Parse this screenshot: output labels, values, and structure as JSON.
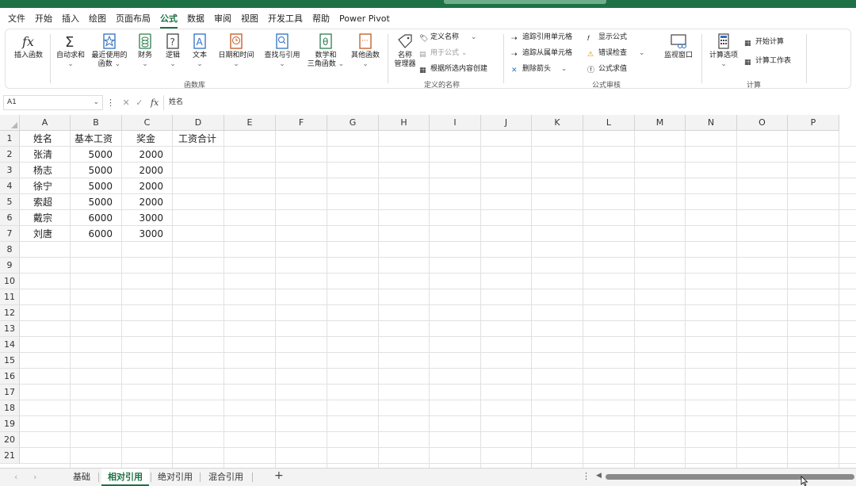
{
  "menu": [
    "文件",
    "开始",
    "插入",
    "绘图",
    "页面布局",
    "公式",
    "数据",
    "审阅",
    "视图",
    "开发工具",
    "帮助",
    "Power Pivot"
  ],
  "active_menu": "公式",
  "ribbon": {
    "insert_function": "插入函数",
    "autosum": "自动求和",
    "recent_line1": "最近使用的",
    "recent_line2": "函数",
    "financial": "财务",
    "logical": "逻辑",
    "text": "文本",
    "datetime": "日期和时间",
    "lookup": "查找与引用",
    "math_line1": "数学和",
    "math_line2": "三角函数",
    "other": "其他函数",
    "group_function_library": "函数库",
    "name_mgr_line1": "名称",
    "name_mgr_line2": "管理器",
    "define_name": "定义名称",
    "use_in_formula": "用于公式",
    "create_from_selection": "根据所选内容创建",
    "group_defined_names": "定义的名称",
    "trace_precedents": "追踪引用单元格",
    "trace_dependents": "追踪从属单元格",
    "remove_arrows": "删除箭头",
    "show_formulas": "显示公式",
    "error_checking": "错误检查",
    "evaluate_formula": "公式求值",
    "group_formula_auditing": "公式审核",
    "watch_window": "监视窗口",
    "calc_options": "计算选项",
    "calc_now": "开始计算",
    "calc_sheet": "计算工作表",
    "group_calculation": "计算"
  },
  "formula_bar": {
    "name_box": "A1",
    "content": "姓名",
    "fx": "fx"
  },
  "columns": [
    "A",
    "B",
    "C",
    "D",
    "E",
    "F",
    "G",
    "H",
    "I",
    "J",
    "K",
    "L",
    "M",
    "N",
    "O",
    "P"
  ],
  "rows": [
    "1",
    "2",
    "3",
    "4",
    "5",
    "6",
    "7",
    "8",
    "9",
    "10",
    "11",
    "12",
    "13",
    "14",
    "15",
    "16",
    "17",
    "18",
    "19",
    "20",
    "21"
  ],
  "headers": [
    "姓名",
    "基本工资",
    "奖金",
    "工资合计"
  ],
  "table": [
    [
      "张清",
      "5000",
      "2000"
    ],
    [
      "杨志",
      "5000",
      "2000"
    ],
    [
      "徐宁",
      "5000",
      "2000"
    ],
    [
      "索超",
      "5000",
      "2000"
    ],
    [
      "戴宗",
      "6000",
      "3000"
    ],
    [
      "刘唐",
      "6000",
      "3000"
    ]
  ],
  "sheet_tabs": [
    "基础",
    "相对引用",
    "绝对引用",
    "混合引用"
  ],
  "active_sheet": "相对引用",
  "colors": {
    "accent": "#1e7145",
    "gridline": "#e1e1e1",
    "header_bg": "#f3f3f3"
  }
}
